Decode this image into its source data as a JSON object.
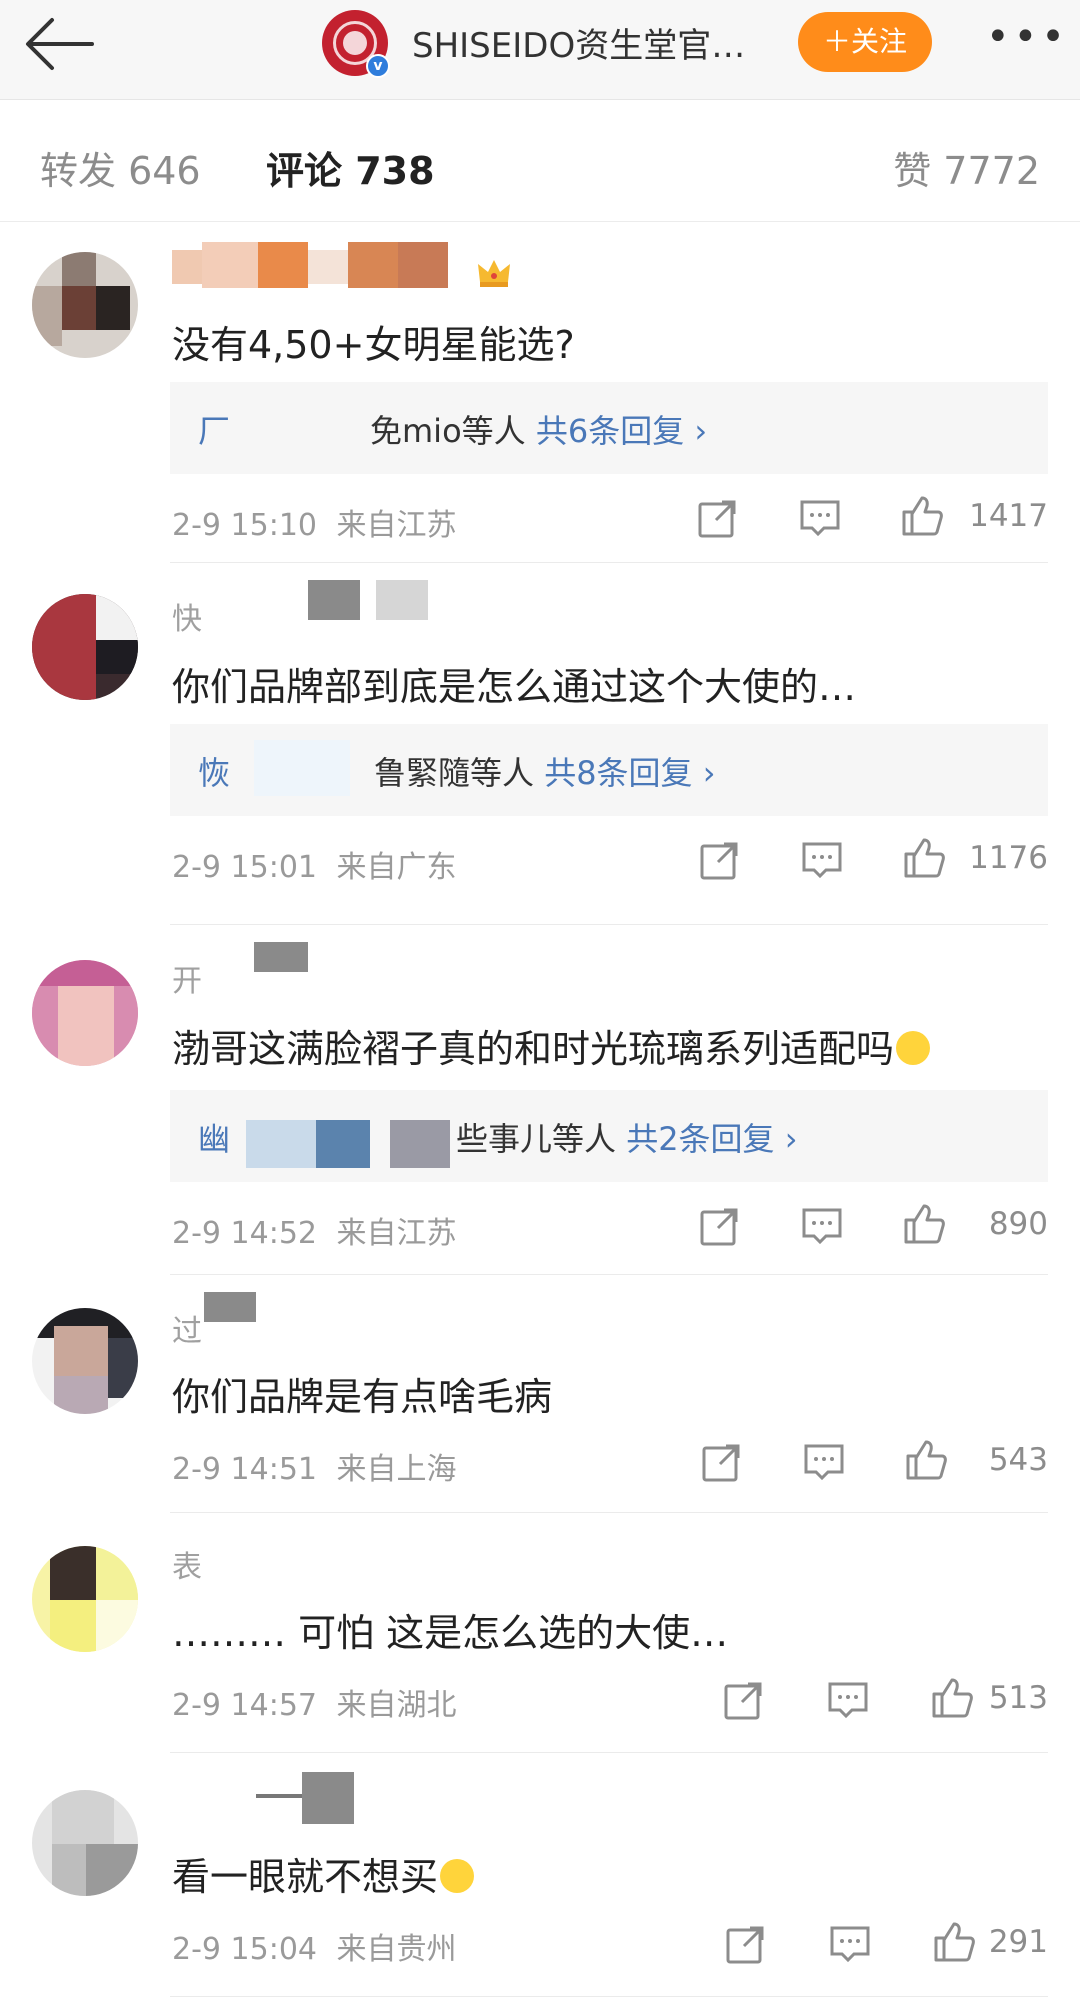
{
  "nav": {
    "account_name": "SHISEIDO资生堂官…",
    "follow_label": "＋关注",
    "more_label": "•••"
  },
  "tabs": {
    "repost": "转发 646",
    "comment": "评论 738",
    "like": "赞 7772"
  },
  "comments": [
    {
      "text": "没有4,50+女明星能选?",
      "replies_prefix": "免mio等人",
      "replies_count": "共6条回复 ›",
      "time": "2-9 15:10",
      "location": "来自江苏",
      "likes": "1417"
    },
    {
      "text": "你们品牌部到底是怎么通过这个大使的…",
      "replies_prefix": "鲁緊隨等人",
      "replies_count": "共8条回复 ›",
      "time": "2-9 15:01",
      "location": "来自广东",
      "likes": "1176"
    },
    {
      "text": "渤哥这满脸褶子真的和时光琉璃系列适配吗",
      "replies_prefix": "些事儿等人",
      "replies_count": "共2条回复 ›",
      "time": "2-9 14:52",
      "location": "来自江苏",
      "likes": "890"
    },
    {
      "text": "你们品牌是有点啥毛病",
      "time": "2-9 14:51",
      "location": "来自上海",
      "likes": "543"
    },
    {
      "text": "……… 可怕 这是怎么选的大使…",
      "time": "2-9 14:57",
      "location": "来自湖北",
      "likes": "513"
    },
    {
      "text": "看一眼就不想买",
      "time": "2-9 15:04",
      "location": "来自贵州",
      "likes": "291"
    }
  ],
  "colors": {
    "follow_bg": "#ff8c1a",
    "link_blue": "#4a78b8",
    "brand_red": "#c3212f"
  }
}
